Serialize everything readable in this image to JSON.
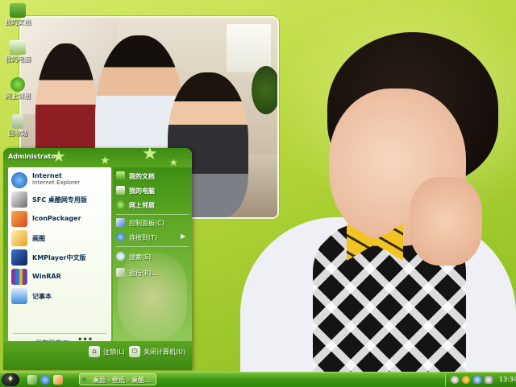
{
  "desktop": {
    "icons": [
      {
        "label": "我的文档",
        "icon": "folder-icon"
      },
      {
        "label": "我的电脑",
        "icon": "computer-icon"
      },
      {
        "label": "网上邻居",
        "icon": "network-icon"
      },
      {
        "label": "回收站",
        "icon": "recycle-bin-icon"
      }
    ]
  },
  "start_menu": {
    "user": "Administrator",
    "programs": [
      {
        "title": "Internet",
        "subtitle": "Internet Explorer",
        "icon": "internet-explorer-icon",
        "color": "#2a78d2"
      },
      {
        "title": "SFC 桌酷网专用版",
        "icon": "sfc-icon",
        "color": "#6d6d6d"
      },
      {
        "title": "IconPackager",
        "icon": "iconpackager-icon",
        "color": "#d9462a"
      },
      {
        "title": "画图",
        "icon": "paint-icon",
        "color": "#e6a21e"
      },
      {
        "title": "KMPlayer中文版",
        "icon": "kmplayer-icon",
        "color": "#1d3f8a"
      },
      {
        "title": "WinRAR",
        "icon": "winrar-icon",
        "color": "#7d3c98"
      },
      {
        "title": "记事本",
        "icon": "notepad-icon",
        "color": "#3c8ad8"
      }
    ],
    "all_programs": "所有程序(P)",
    "all_programs_more": "•••",
    "places": [
      {
        "label": "我的文档",
        "bold": true,
        "icon": "documents-icon"
      },
      {
        "label": "我的电脑",
        "bold": true,
        "icon": "computer-icon"
      },
      {
        "label": "网上邻居",
        "bold": true,
        "icon": "network-icon"
      },
      {
        "label": "控制面板(C)",
        "bold": false,
        "icon": "control-panel-icon"
      },
      {
        "label": "连接到(T)",
        "bold": false,
        "icon": "connect-icon"
      },
      {
        "label": "搜索(S)",
        "bold": false,
        "icon": "search-icon"
      },
      {
        "label": "运行(R)...",
        "bold": false,
        "icon": "run-icon"
      }
    ],
    "logoff": "注销(L)",
    "shutdown": "关闭计算机(U)"
  },
  "taskbar": {
    "task_label": "桌面 - 壁纸 - 桌酷...",
    "clock": "13:34"
  }
}
